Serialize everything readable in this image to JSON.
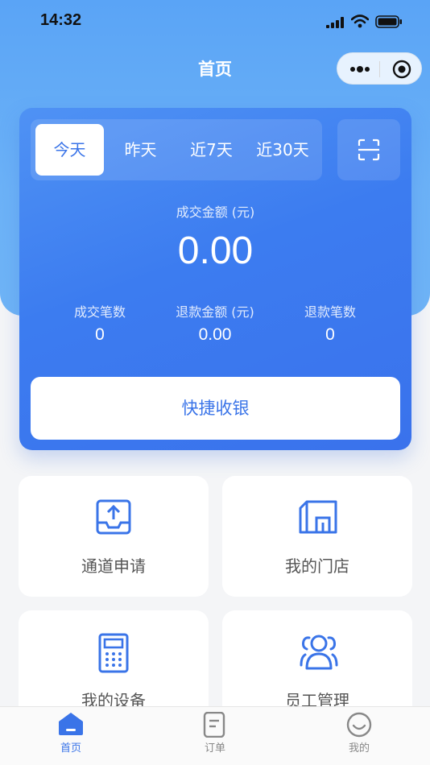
{
  "status": {
    "time": "14:32"
  },
  "nav": {
    "title": "首页"
  },
  "period_tabs": [
    {
      "label": "今天",
      "active": true
    },
    {
      "label": "昨天",
      "active": false
    },
    {
      "label": "近7天",
      "active": false
    },
    {
      "label": "近30天",
      "active": false
    }
  ],
  "summary": {
    "amount_label": "成交金额 (元)",
    "amount_value": "0.00",
    "stats": [
      {
        "label": "成交笔数",
        "value": "0"
      },
      {
        "label": "退款金额 (元)",
        "value": "0.00"
      },
      {
        "label": "退款笔数",
        "value": "0"
      }
    ],
    "quick_button": "快捷收银"
  },
  "tiles": [
    {
      "label": "通道申请",
      "icon": "upload-tray-icon"
    },
    {
      "label": "我的门店",
      "icon": "store-icon"
    },
    {
      "label": "我的设备",
      "icon": "calculator-icon"
    },
    {
      "label": "员工管理",
      "icon": "staff-icon"
    }
  ],
  "tabbar": [
    {
      "label": "首页",
      "icon": "home-icon",
      "active": true
    },
    {
      "label": "订单",
      "icon": "order-icon",
      "active": false
    },
    {
      "label": "我的",
      "icon": "profile-icon",
      "active": false
    }
  ],
  "colors": {
    "primary": "#3a74e8",
    "hero": "#5aa4f6"
  }
}
